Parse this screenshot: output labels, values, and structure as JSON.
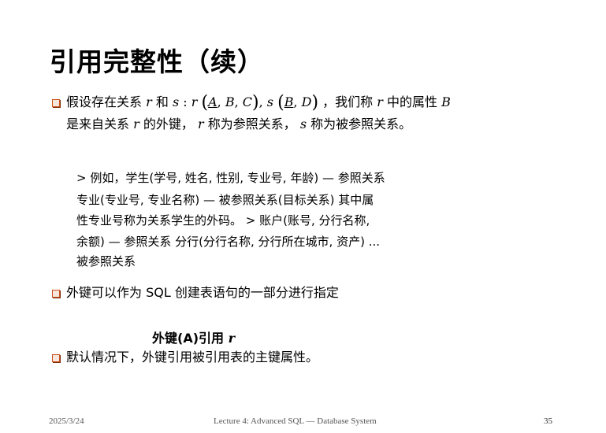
{
  "slide": {
    "title": "引用完整性（续）",
    "bullet1": {
      "line1_pre": "假设存在关系",
      "r": "r",
      "and": "和",
      "s_expr_1": "s",
      "colon": " : ",
      "schema_r": "r",
      "A": "A",
      "B": "B",
      "C": "C",
      "s_expr_2": "s",
      "B2": "B",
      "D": "D",
      "line1_post": "，我们称",
      "r2": "r",
      "attr_text": "中的属性",
      "attrB": "B",
      "line2_pre": "是来自关系",
      "r3": "r",
      "line2_mid": "的外键，",
      "r4": "r",
      "line2_mid2": "称为参照关系，",
      "s4": "s",
      "line2_post": "称为被参照关系。"
    },
    "example_lines": [
      "> 例如，学生(学号, 姓名, 性别, 专业号, 年龄) — 参照关系",
      "专业(专业号, 专业名称) — 被参照关系(目标关系) 其中属",
      "性专业号称为关系学生的外码。 > 账户(账号, 分行名称,",
      "余额) — 参照关系 分行(分行名称, 分行所在城市, 资产) ...",
      "被参照关系"
    ],
    "bullet2": "外键可以作为 SQL 创建表语句的一部分进行指定",
    "fk_syntax_text": "外键(A)引用",
    "fk_syntax_rel": "r",
    "bullet3": "默认情况下，外键引用被引用表的主键属性。",
    "footer": {
      "date": "2025/3/24",
      "course": "Lecture 4: Advanced SQL — Database System",
      "page": "35"
    },
    "colors": {
      "bullet_border": "#c9501a",
      "bullet_fill": "#f6e6dc",
      "footer_text": "#555555"
    }
  }
}
